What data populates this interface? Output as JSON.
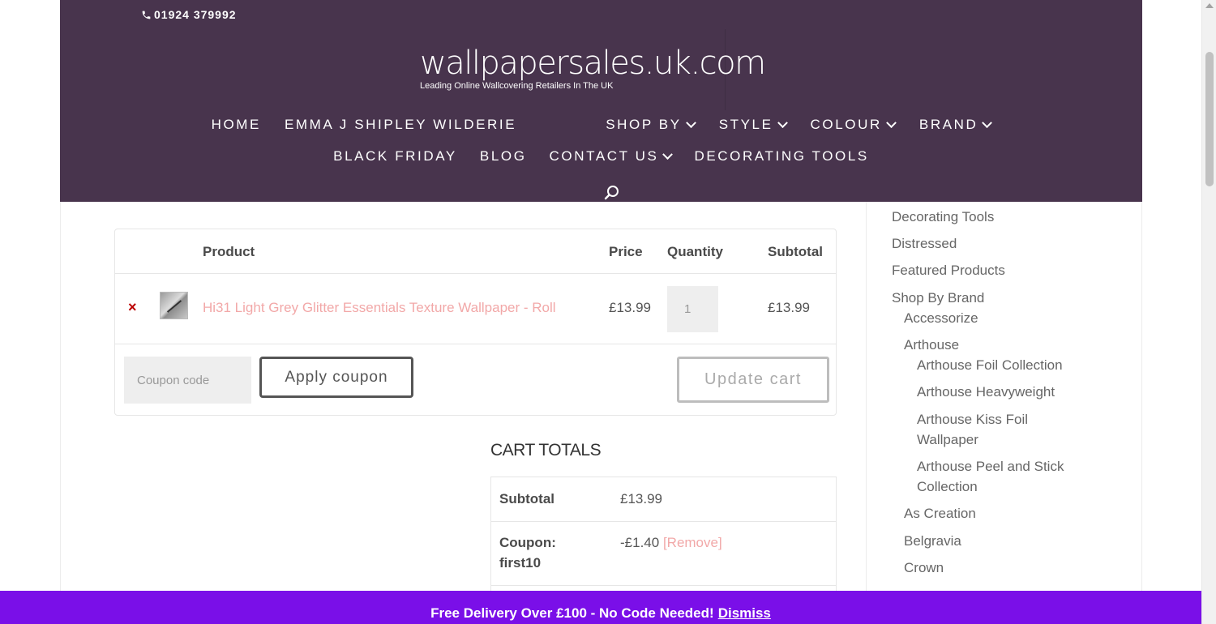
{
  "header": {
    "phone": "01924 379992",
    "logo_main": "wallpapersales.uk.com",
    "logo_tagline": "Leading Online Wallcovering Retailers In The UK",
    "nav_row1": [
      {
        "label": "HOME",
        "has_dropdown": false
      },
      {
        "label": "EMMA J SHIPLEY WILDERIE",
        "has_dropdown": false
      },
      {
        "label": "SHOP BY",
        "has_dropdown": true
      },
      {
        "label": "STYLE",
        "has_dropdown": true
      },
      {
        "label": "COLOUR",
        "has_dropdown": true
      },
      {
        "label": "BRAND",
        "has_dropdown": true
      }
    ],
    "nav_row2": [
      {
        "label": "BLACK FRIDAY",
        "has_dropdown": false
      },
      {
        "label": "BLOG",
        "has_dropdown": false
      },
      {
        "label": "CONTACT US",
        "has_dropdown": true
      },
      {
        "label": "DECORATING TOOLS",
        "has_dropdown": false
      }
    ],
    "search_icon": "search-icon"
  },
  "cart": {
    "columns": [
      "Product",
      "Price",
      "Quantity",
      "Subtotal"
    ],
    "items": [
      {
        "name": "Hi31 Light Grey Glitter Essentials Texture Wallpaper - Roll",
        "price": "£13.99",
        "quantity": "1",
        "subtotal": "£13.99"
      }
    ],
    "remove_symbol": "×",
    "coupon_placeholder": "Coupon code",
    "apply_coupon_label": "Apply coupon",
    "update_cart_label": "Update cart"
  },
  "totals": {
    "title": "CART TOTALS",
    "subtotal_label": "Subtotal",
    "subtotal_value": "£13.99",
    "coupon_label_line1": "Coupon:",
    "coupon_label_line2": "first10",
    "coupon_value": "-£1.40",
    "coupon_remove": "[Remove]"
  },
  "sidebar": {
    "items": [
      "Decorating Tools",
      "Distressed",
      "Featured Products",
      "Shop By Brand",
      "Accessorize",
      "Arthouse",
      "Arthouse Foil Collection",
      "Arthouse Heavyweight",
      "Arthouse Kiss Foil",
      "Wallpaper",
      "Arthouse Peel and Stick",
      "Collection",
      "As Creation",
      "Belgravia",
      "Crown"
    ]
  },
  "banner": {
    "text": "Free Delivery Over £100 - No Code Needed!",
    "dismiss": "Dismiss"
  },
  "colors": {
    "header_bg": "#48344d",
    "banner_bg": "#7a0fe8",
    "link_pink": "#f2a8a8",
    "remove_red": "#bb0000"
  }
}
